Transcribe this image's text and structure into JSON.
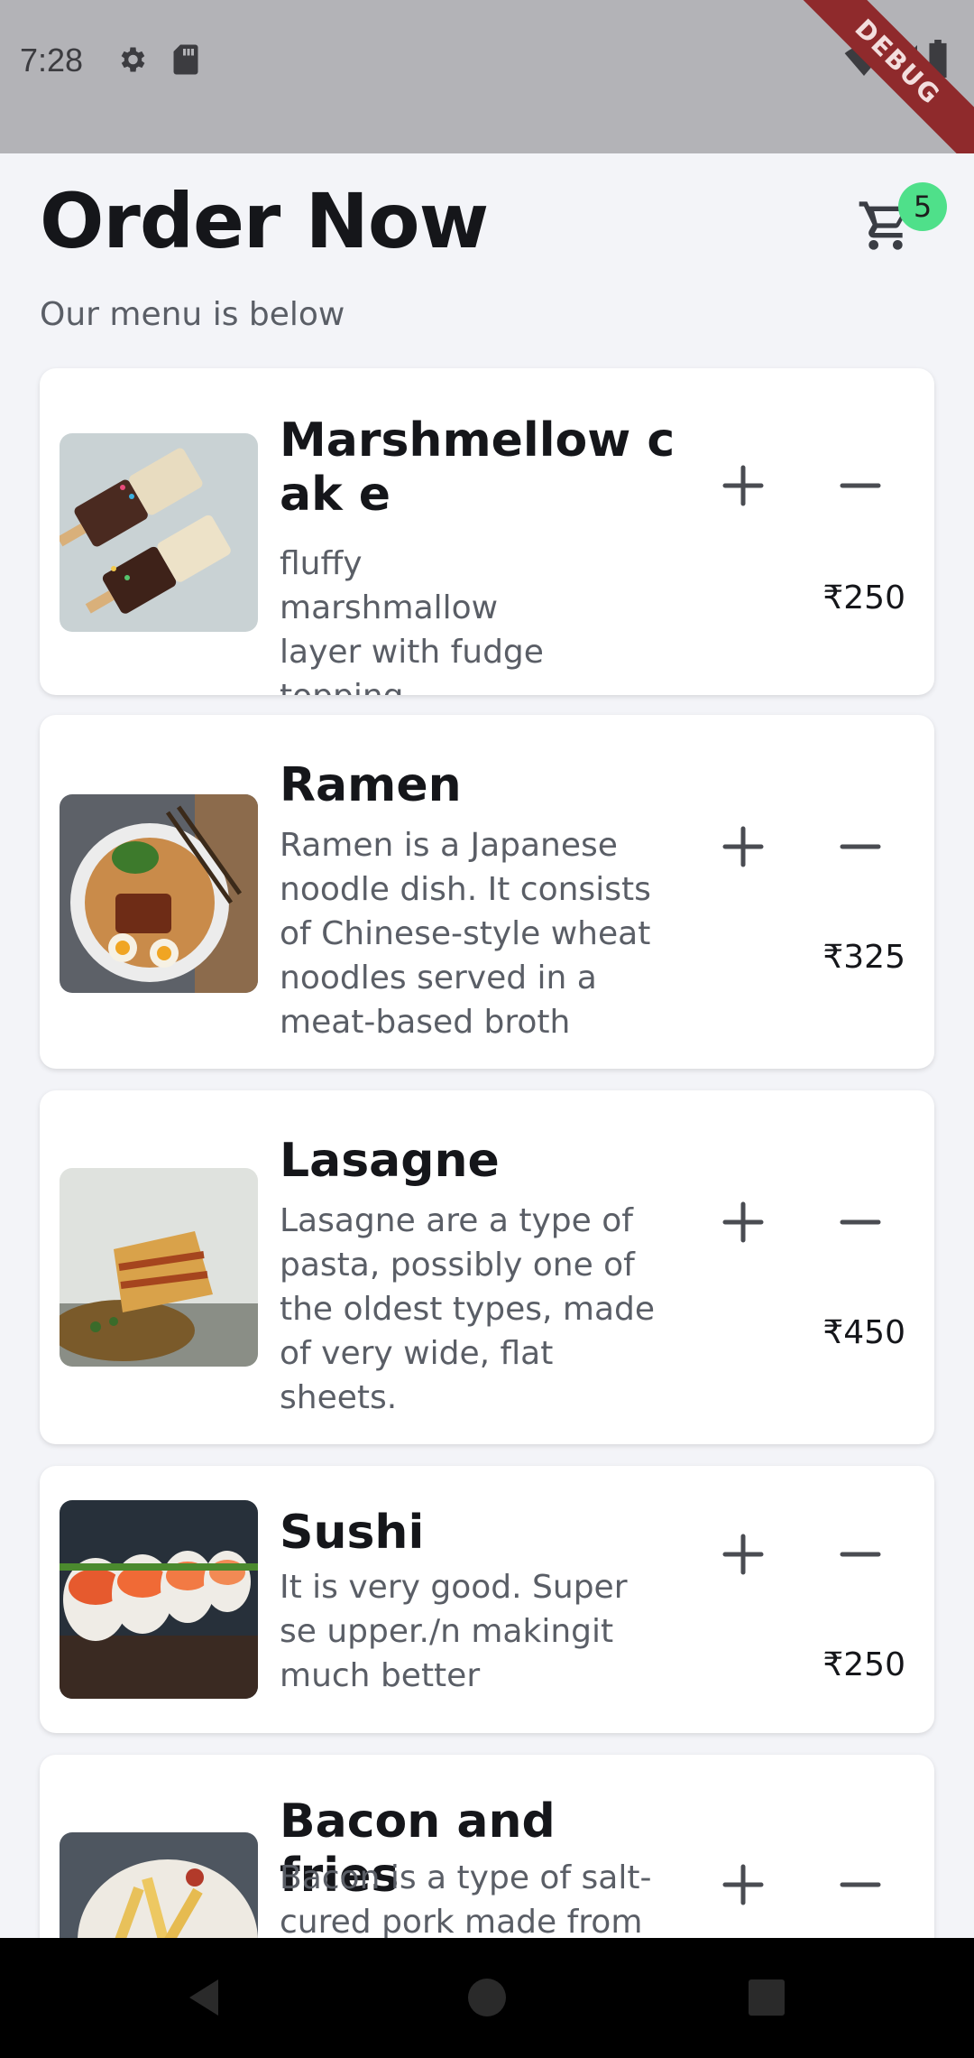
{
  "status_bar": {
    "time": "7:28",
    "icons": [
      "settings-gear-icon",
      "sd-card-icon",
      "wifi-icon",
      "signal-icon",
      "battery-icon"
    ],
    "debug_label": "DEBUG"
  },
  "header": {
    "title": "Order Now",
    "subtitle": "Our menu is below",
    "cart_count": "5"
  },
  "menu": {
    "items": [
      {
        "name": "Marshmellow cak e",
        "description": "fluffy marshmallow layer with fudge topping",
        "price": "₹250",
        "image": "marshmallow-cake-photo"
      },
      {
        "name": "Ramen",
        "description": "Ramen is a Japanese noodle dish. It consists of Chinese-style wheat noodles served in a meat-based broth",
        "price": "₹325",
        "image": "ramen-bowl-photo"
      },
      {
        "name": "Lasagne",
        "description": "Lasagne are a type of pasta, possibly one of the oldest types, made of very wide, flat sheets.",
        "price": "₹450",
        "image": "lasagne-photo"
      },
      {
        "name": "Sushi",
        "description": "It is very good. Super se upper./n makingit much better",
        "price": "₹250",
        "image": "sushi-photo"
      },
      {
        "name": "Bacon and fries",
        "description": "Bacon is a type of salt-cured pork made from",
        "price": "",
        "image": "bacon-fries-photo"
      }
    ]
  },
  "colors": {
    "background": "#f3f4f8",
    "status_bar": "#b3b3b7",
    "badge": "#4fe08a",
    "debug_ribbon": "#8f2a2c",
    "nav_bar": "#000000"
  }
}
